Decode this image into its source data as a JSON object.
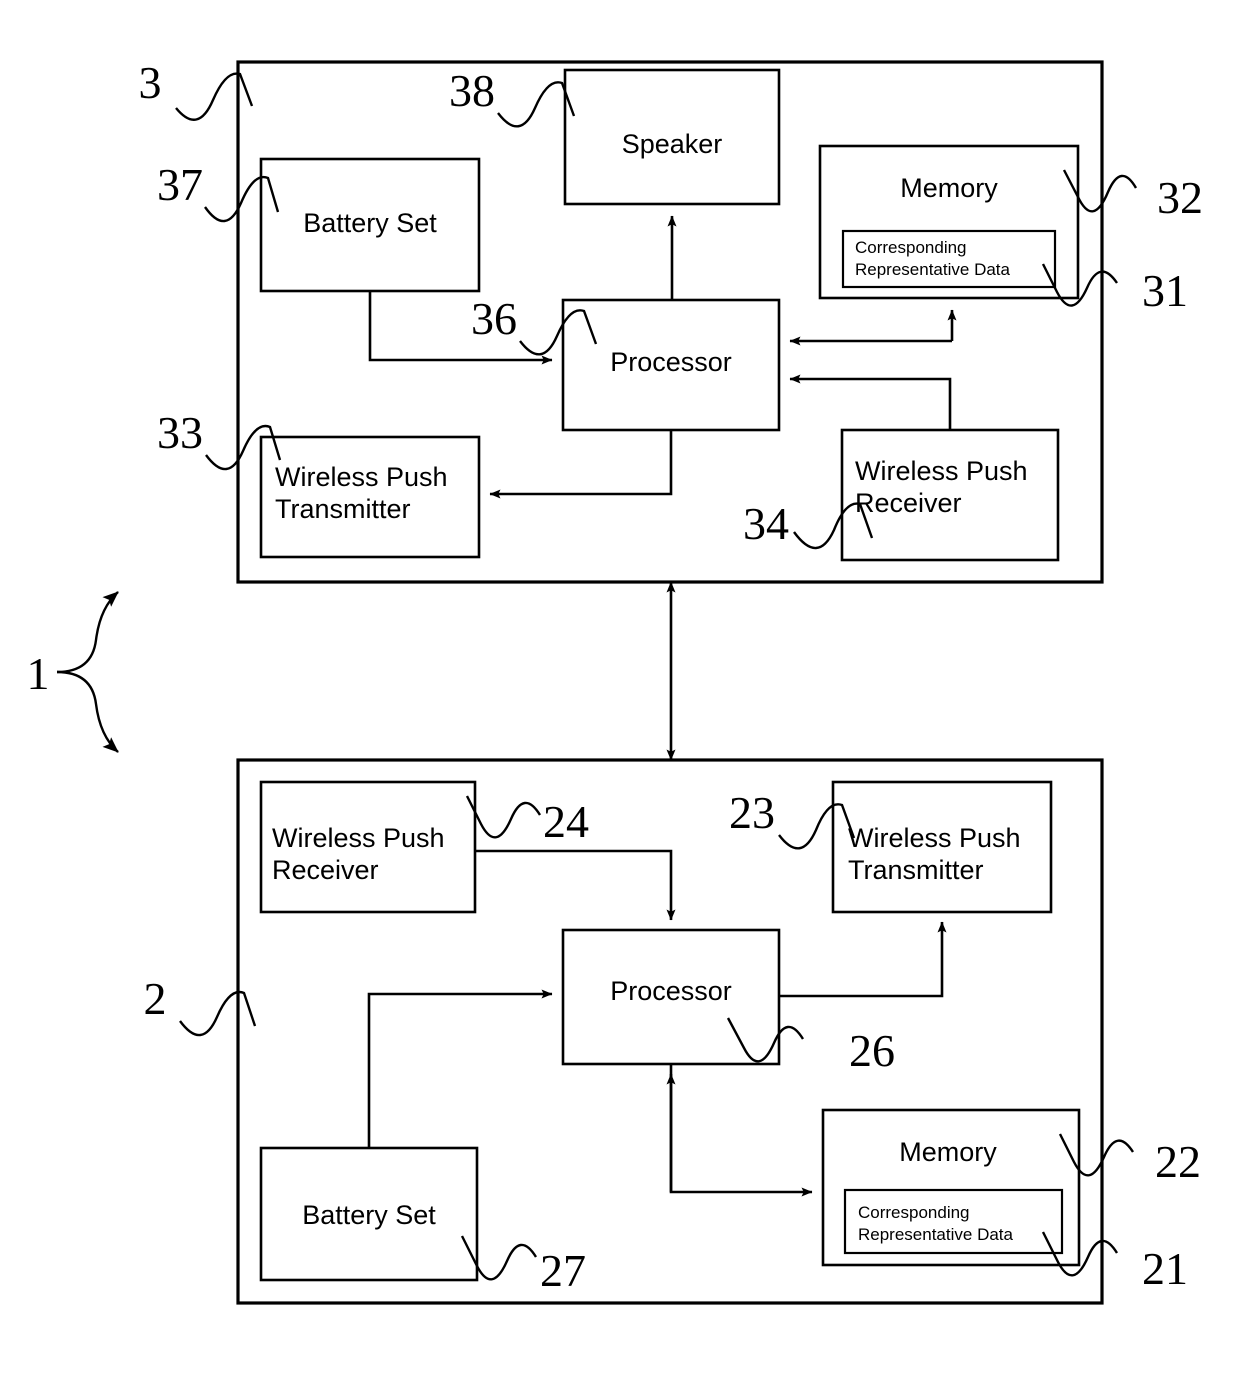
{
  "figure": {
    "type": "patent-block-diagram",
    "background": "#ffffff",
    "line_color": "#000000"
  },
  "system": {
    "reference": "1"
  },
  "panels": [
    {
      "id": "panel-3",
      "reference": "3",
      "blocks": {
        "battery_set": {
          "label": "Battery Set",
          "reference": "37"
        },
        "speaker": {
          "label": "Speaker",
          "reference": "38"
        },
        "memory": {
          "label": "Memory",
          "reference": "32"
        },
        "memory_inner": {
          "line1": "Corresponding",
          "line2": "Representative Data",
          "reference": "31"
        },
        "processor": {
          "label": "Processor",
          "reference": "36"
        },
        "wireless_push_transmitter": {
          "line1": "Wireless Push",
          "line2": "Transmitter",
          "reference": "33"
        },
        "wireless_push_receiver": {
          "line1": "Wireless Push",
          "line2": "Receiver",
          "reference": "34"
        }
      }
    },
    {
      "id": "panel-2",
      "reference": "2",
      "blocks": {
        "wireless_push_receiver": {
          "line1": "Wireless Push",
          "line2": "Receiver",
          "reference": "24"
        },
        "wireless_push_transmitter": {
          "line1": "Wireless Push",
          "line2": "Transmitter",
          "reference": "23"
        },
        "processor": {
          "label": "Processor",
          "reference": "26"
        },
        "battery_set": {
          "label": "Battery Set",
          "reference": "27"
        },
        "memory": {
          "label": "Memory",
          "reference": "22"
        },
        "memory_inner": {
          "line1": "Corresponding",
          "line2": "Representative Data",
          "reference": "21"
        }
      }
    }
  ]
}
